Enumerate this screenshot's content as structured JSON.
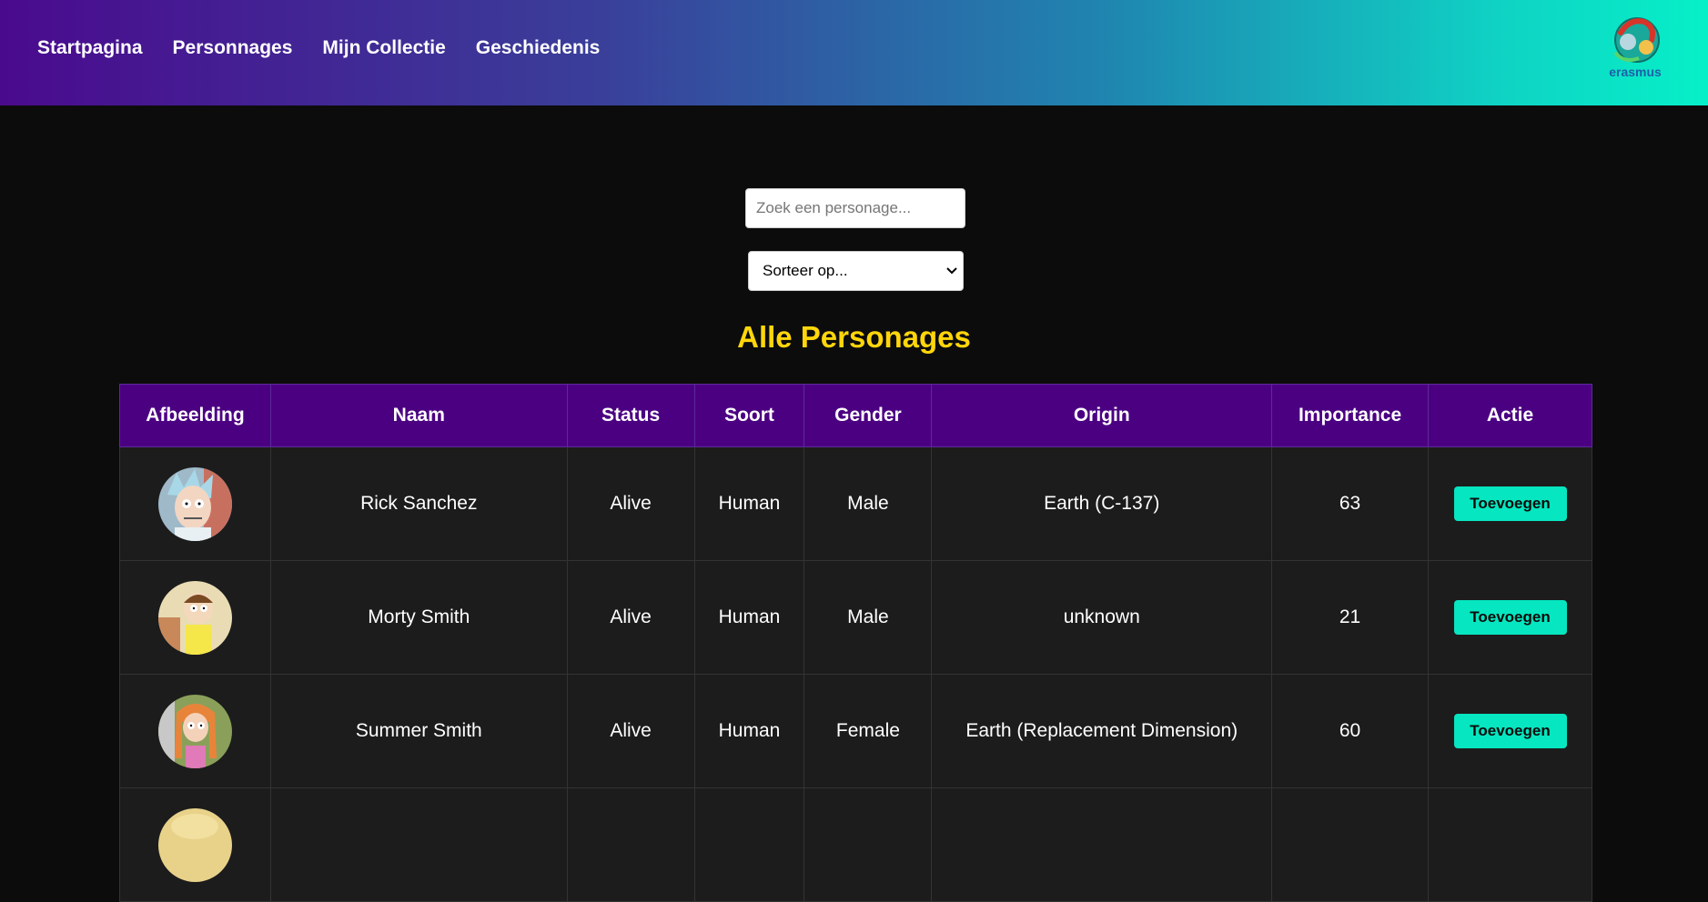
{
  "nav": {
    "links": [
      "Startpagina",
      "Personnages",
      "Mijn Collectie",
      "Geschiedenis"
    ],
    "logo_text": "erasmus"
  },
  "search": {
    "placeholder": "Zoek een personage..."
  },
  "sort": {
    "selected": "Sorteer op..."
  },
  "main": {
    "title": "Alle Personages"
  },
  "table": {
    "headers": [
      "Afbeelding",
      "Naam",
      "Status",
      "Soort",
      "Gender",
      "Origin",
      "Importance",
      "Actie"
    ],
    "rows": [
      {
        "name": "Rick Sanchez",
        "status": "Alive",
        "species": "Human",
        "gender": "Male",
        "origin": "Earth (C-137)",
        "importance": "63",
        "action": "Toevoegen"
      },
      {
        "name": "Morty Smith",
        "status": "Alive",
        "species": "Human",
        "gender": "Male",
        "origin": "unknown",
        "importance": "21",
        "action": "Toevoegen"
      },
      {
        "name": "Summer Smith",
        "status": "Alive",
        "species": "Human",
        "gender": "Female",
        "origin": "Earth (Replacement Dimension)",
        "importance": "60",
        "action": "Toevoegen"
      },
      {
        "name": "",
        "status": "",
        "species": "",
        "gender": "",
        "origin": "",
        "importance": "",
        "action": ""
      }
    ]
  },
  "colors": {
    "header_gradient_start": "#4a0a8e",
    "header_gradient_end": "#06f0c8",
    "title": "#ffd60a",
    "table_header": "#4b0082",
    "button": "#06e6c0",
    "background": "#0c0c0c"
  }
}
